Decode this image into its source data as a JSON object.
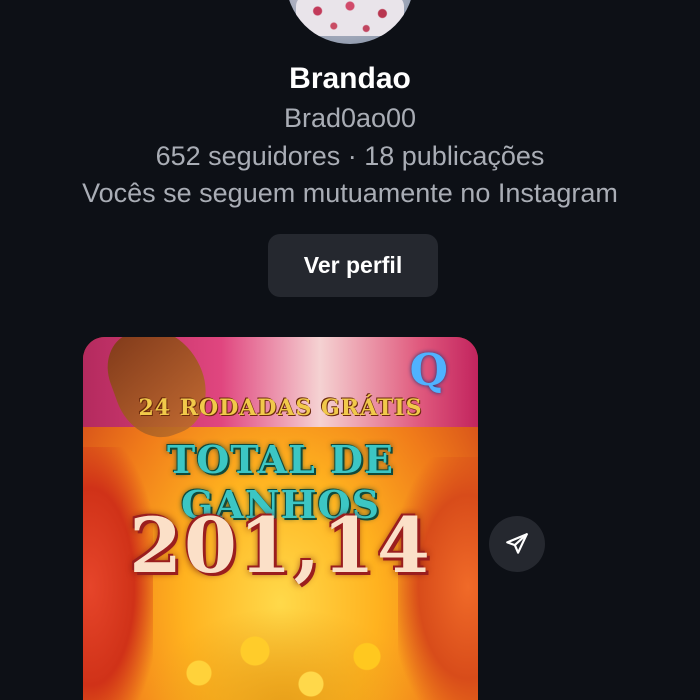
{
  "profile": {
    "name": "Brandao",
    "username": "Brad0ao00",
    "stats": "652 seguidores · 18 publicações",
    "mutual_text": "Vocês se seguem mutuamente no Instagram",
    "view_profile_label": "Ver perfil"
  },
  "post": {
    "banner_text": "24 RODADAS GRÁTIS",
    "headline": "TOTAL DE GANHOS",
    "amount": "201,14",
    "logo_letter": "Q"
  },
  "icons": {
    "share": "paper-plane-icon"
  },
  "colors": {
    "background": "#0d1016",
    "button": "#25282f",
    "text_primary": "#ffffff",
    "text_secondary": "#a9adb5"
  }
}
